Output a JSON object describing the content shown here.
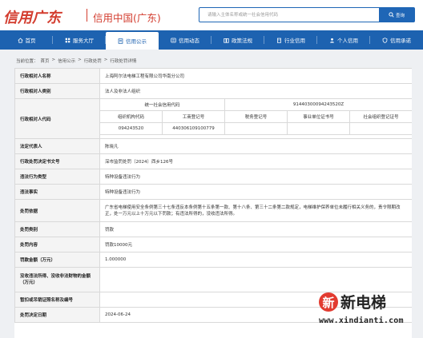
{
  "header": {
    "logo_cursive": "信用广东",
    "logo_main": "信用中国(广东)",
    "search_placeholder": "请输入主体名称或统一社会信用代码",
    "search_button": "查询"
  },
  "nav": [
    {
      "label": "首页",
      "icon": "home-icon"
    },
    {
      "label": "服务大厅",
      "icon": "grid-icon"
    },
    {
      "label": "信用公示",
      "icon": "document-icon",
      "active": true
    },
    {
      "label": "信用动态",
      "icon": "news-icon"
    },
    {
      "label": "政策法规",
      "icon": "book-icon"
    },
    {
      "label": "行业信用",
      "icon": "building-icon"
    },
    {
      "label": "个人信用",
      "icon": "user-icon"
    },
    {
      "label": "信用承诺",
      "icon": "shield-icon"
    }
  ],
  "breadcrumb": {
    "prefix": "当前位置：",
    "items": [
      "首页",
      "信用公示",
      "行政处罚",
      "行政处罚详情"
    ],
    "sep": ">"
  },
  "record": {
    "party_name_label": "行政相对人名称",
    "party_name": "上海阿尔法电梯工程有限公司华南分公司",
    "party_type_label": "行政相对人类别",
    "party_type": "法人及非法人组织",
    "party_code_label": "行政相对人代码",
    "uscc_label": "统一社会信用代码",
    "uscc": "91440300094243520Z",
    "code_headers": [
      "组织机构代码",
      "工商登记号",
      "税务登记号",
      "事业单位证书号",
      "社会组织登记证号"
    ],
    "code_values": [
      "094243520",
      "440306109100779",
      "",
      "",
      ""
    ],
    "legal_rep_label": "法定代表人",
    "legal_rep": "陈晓凡",
    "doc_no_label": "行政处罚决定书文号",
    "doc_no": "深市监罚处罚〔2024〕西乡126号",
    "violation_type_label": "违法行为类型",
    "violation_type": "特种设备违法行为",
    "violation_fact_label": "违法事实",
    "violation_fact": "特种设备违法行为",
    "basis_label": "处罚依据",
    "basis": "广东省电梯使用安全条例第三十七条违反本条例第十五条第一款、第十八条、第三十二条第二款规定，电梯维护保养单位未履行相关义务的，责令限期改正，处一万元以上十万元以下罚款；有违法所得的，没收违法所得。",
    "category_label": "处罚类别",
    "category": "罚款",
    "content_label": "处罚内容",
    "content": "罚款10000元",
    "amount_label": "罚款金额（万元）",
    "amount": "1.000000",
    "confiscation_label": "没收违法所得、没收非法财物的金额（万元）",
    "confiscation": "",
    "license_label": "暂扣或吊销证照名称及编号",
    "license": "",
    "date_label": "处罚决定日期",
    "date": "2024-06-24"
  },
  "watermark": {
    "icon_char": "新",
    "title": "新电梯",
    "url": "www.xindianti.com"
  }
}
